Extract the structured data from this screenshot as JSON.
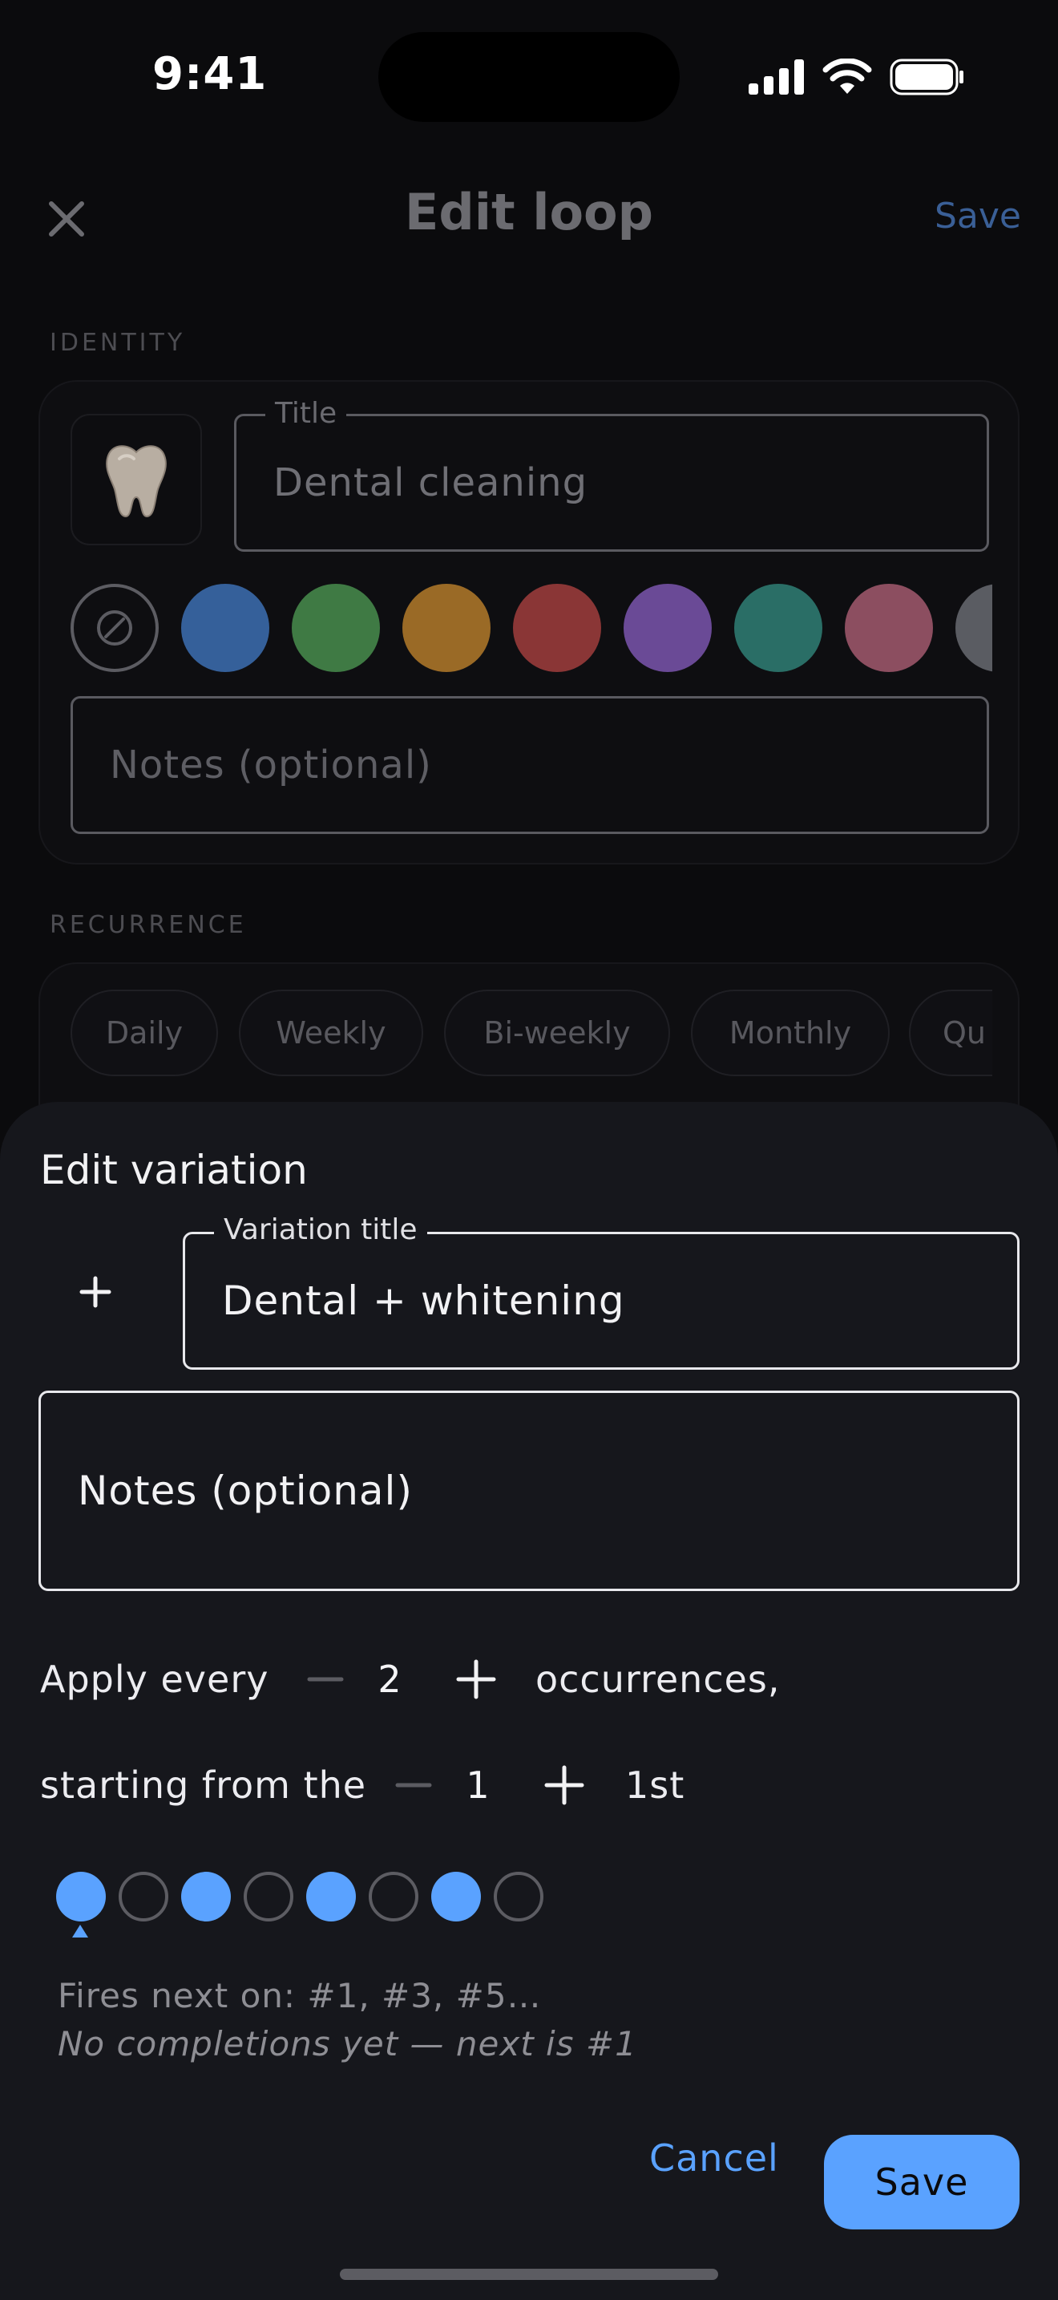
{
  "status_bar": {
    "time": "9:41"
  },
  "nav": {
    "title": "Edit loop",
    "save_label": "Save"
  },
  "identity": {
    "section_label": "IDENTITY",
    "emoji": "🦷",
    "title_legend": "Title",
    "title_value": "Dental cleaning",
    "notes_placeholder": "Notes (optional)",
    "colors": [
      "none",
      "#35609a",
      "#3f7a44",
      "#9a6a26",
      "#8a3636",
      "#6a4a96",
      "#2a6e66",
      "#8c4e60",
      "#5a5c62"
    ]
  },
  "recurrence": {
    "section_label": "RECURRENCE",
    "options": [
      "Daily",
      "Weekly",
      "Bi-weekly",
      "Monthly",
      "Qu"
    ]
  },
  "sheet": {
    "title": "Edit variation",
    "variation_legend": "Variation title",
    "variation_value": "Dental + whitening",
    "notes_placeholder": "Notes (optional)",
    "apply_prefix": "Apply every",
    "apply_count": "2",
    "apply_suffix": "occurrences,",
    "start_prefix": "starting from the",
    "start_count": "1",
    "start_ordinal": "1st",
    "pattern": [
      true,
      false,
      true,
      false,
      true,
      false,
      true,
      false
    ],
    "fires_next": "Fires next on: #1, #3, #5…",
    "hint": "No completions yet — next is #1",
    "cancel_label": "Cancel",
    "save_label": "Save",
    "accent": "#5aa2ff"
  }
}
